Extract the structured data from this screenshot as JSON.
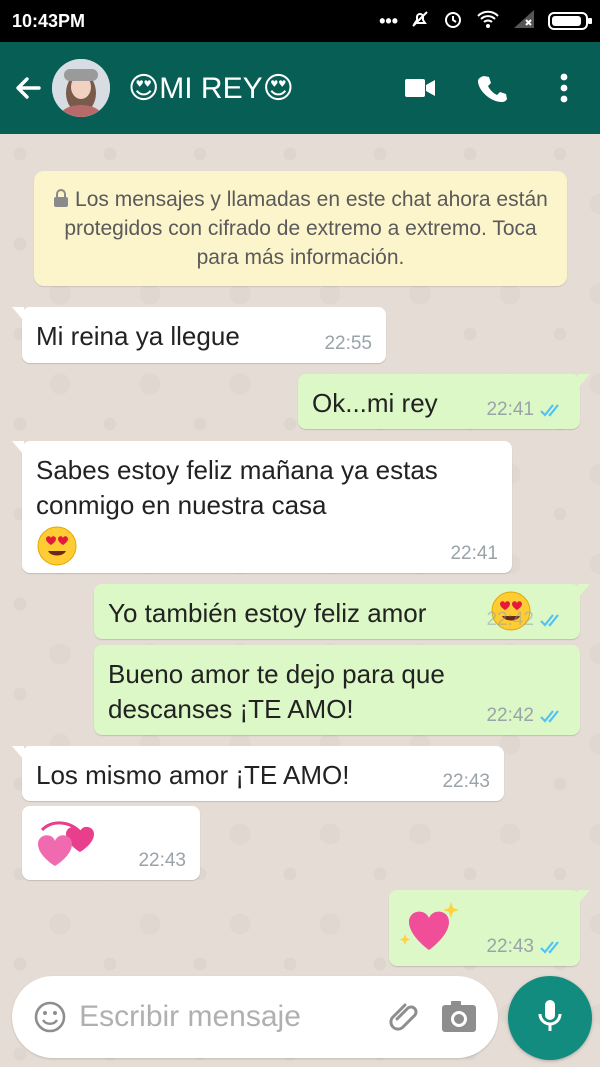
{
  "status_bar": {
    "time": "10:43PM",
    "icons": [
      "dots-icon",
      "mute-icon",
      "alarm-icon",
      "wifi-icon",
      "signal-icon",
      "battery-icon"
    ],
    "battery_fill_fraction": 0.9
  },
  "app_bar": {
    "contact_name": "😍MI REY😍",
    "icons": [
      "back-arrow-icon",
      "avatar",
      "video-call-icon",
      "phone-icon",
      "more-vert-icon"
    ],
    "color": "#075e54"
  },
  "encryption_notice": "Los mensajes y llamadas en este chat ahora están protegidos con cifrado de extremo a extremo. Toca para más información.",
  "messages": [
    {
      "dir": "in",
      "text": "Mi reina ya llegue",
      "time": "22:55"
    },
    {
      "dir": "out",
      "text": "Ok...mi rey",
      "time": "22:41",
      "read": true
    },
    {
      "dir": "in",
      "text": "Sabes estoy feliz mañana ya estas conmigo en nuestra casa",
      "emoji": "😍",
      "time": "22:41"
    },
    {
      "dir": "out",
      "text": "Yo también estoy feliz amor",
      "emoji": "😍",
      "time": "22:42",
      "read": true
    },
    {
      "dir": "out",
      "text": "Bueno amor te dejo para que descanses ¡TE AMO!",
      "time": "22:42",
      "read": true
    },
    {
      "dir": "in",
      "text": "Los mismo amor ¡TE AMO!",
      "time": "22:43"
    },
    {
      "dir": "in",
      "emoji": "💞",
      "time": "22:43"
    },
    {
      "dir": "out",
      "emoji": "💖",
      "time": "22:43",
      "read": true
    }
  ],
  "input": {
    "placeholder": "Escribir mensaje",
    "icons": [
      "emoji-icon",
      "attach-icon",
      "camera-icon",
      "mic-icon"
    ]
  },
  "colors": {
    "incoming_bubble": "#ffffff",
    "outgoing_bubble": "#dcf8c6",
    "chat_background": "#e5ddd5",
    "notice_background": "#fcf4cb",
    "read_tick": "#4fc3f7"
  }
}
